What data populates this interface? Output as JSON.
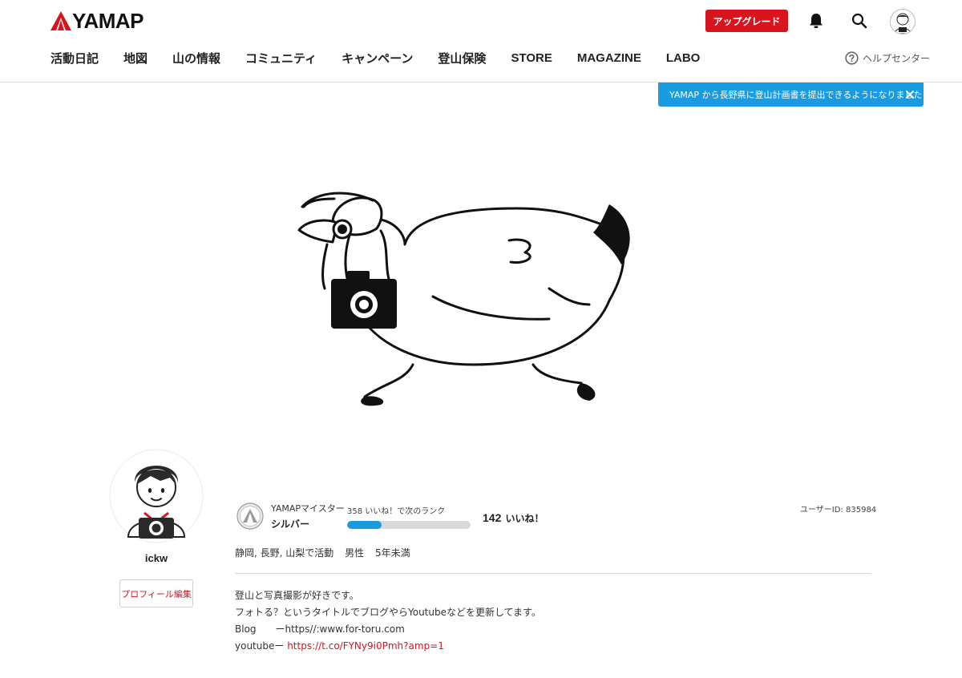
{
  "header": {
    "logo_text": "YAMAP",
    "upgrade_label": "アップグレード",
    "icons": [
      "bell-icon",
      "search-icon",
      "avatar"
    ]
  },
  "nav": {
    "items": [
      {
        "label": "活動日記"
      },
      {
        "label": "地図"
      },
      {
        "label": "山の情報"
      },
      {
        "label": "コミュニティ"
      },
      {
        "label": "キャンペーン"
      },
      {
        "label": "登山保険"
      },
      {
        "label": "STORE"
      },
      {
        "label": "MAGAZINE"
      },
      {
        "label": "LABO"
      }
    ],
    "help_label": "ヘルプセンター"
  },
  "notice": {
    "text": "YAMAP から長野県に登山計画書を提出できるようになりました"
  },
  "profile": {
    "username": "ickw",
    "edit_label": "プロフィール編集",
    "rank_title": "YAMAPマイスター",
    "rank_name": "シルバー",
    "progress_label": "358 いいね！で次のランク",
    "progress_fraction": 0.28,
    "likes_count": "142",
    "likes_unit": "いいね！",
    "user_id": "ユーザーID: 835984",
    "activity": [
      "静岡, 長野, 山梨で活動",
      "男性",
      "5年未満"
    ],
    "bio": {
      "line1": "登山と写真撮影が好きです。",
      "line2": "フォトる？というタイトルでブログやらYoutubeなどを更新してます。",
      "line3": "Blog　　ーhttps//:www.for-toru.com",
      "line4_prefix": "youtubeー ",
      "line4_link": "https://t.co/FYNy9i0Pmh?amp=1"
    }
  },
  "colors": {
    "brand_red": "#d9141d",
    "accent_blue": "#1a9be0",
    "progress_track": "#d9d9d9"
  }
}
